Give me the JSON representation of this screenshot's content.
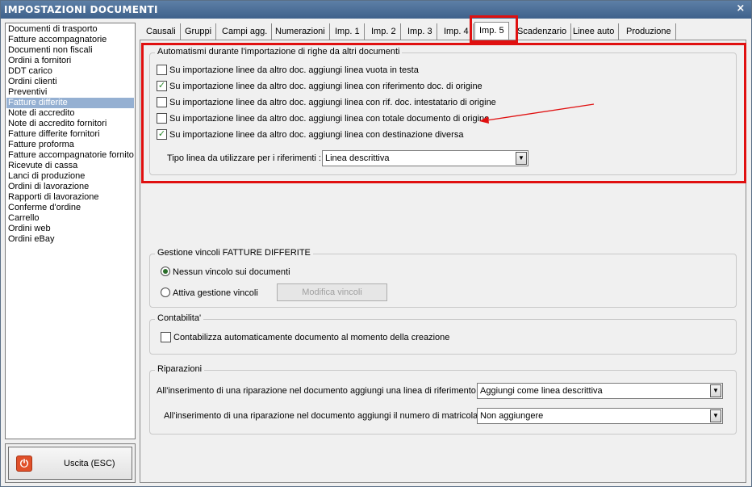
{
  "window": {
    "title": "IMPOSTAZIONI DOCUMENTI",
    "close_glyph": "×"
  },
  "doclist": {
    "items": [
      "Documenti di trasporto",
      "Fatture accompagnatorie",
      "Documenti non fiscali",
      "Ordini a fornitori",
      "DDT carico",
      "Ordini clienti",
      "Preventivi",
      "Fatture differite",
      "Note di accredito",
      "Note di accredito fornitori",
      "Fatture differite fornitori",
      "Fatture proforma",
      "Fatture accompagnatorie fornito",
      "Ricevute di cassa",
      "Lanci di produzione",
      "Ordini di lavorazione",
      "Rapporti di lavorazione",
      "Conferme d'ordine",
      "Carrello",
      "Ordini web",
      "Ordini eBay"
    ],
    "selected_index": 7
  },
  "exit": {
    "label": "Uscita (ESC)",
    "icon": "power-icon"
  },
  "tabs": [
    "Causali",
    "Gruppi",
    "Campi agg.",
    "Numerazioni",
    "Imp. 1",
    "Imp. 2",
    "Imp. 3",
    "Imp. 4",
    "Imp. 5",
    "Scadenzario",
    "Linee auto",
    "Produzione"
  ],
  "active_tab": "Imp. 5",
  "automatismi": {
    "title": "Automatismi durante l'importazione di righe da altri documenti",
    "options": [
      {
        "label": "Su importazione linee da altro doc. aggiungi linea vuota in testa",
        "checked": false
      },
      {
        "label": "Su importazione linee da altro doc. aggiungi linea con riferimento doc. di origine",
        "checked": true
      },
      {
        "label": "Su importazione linee da altro doc. aggiungi linea con rif. doc. intestatario di origine",
        "checked": false
      },
      {
        "label": "Su importazione linee da altro doc. aggiungi linea con totale documento di origine",
        "checked": false
      },
      {
        "label": "Su importazione linee da altro doc. aggiungi linea con destinazione diversa",
        "checked": true
      }
    ],
    "tipo_linea_label": "Tipo linea da utilizzare per i riferimenti :",
    "tipo_linea_value": "Linea descrittiva"
  },
  "vincoli": {
    "title": "Gestione vincoli FATTURE DIFFERITE",
    "option_none": "Nessun vincolo sui documenti",
    "option_attiva": "Attiva gestione vincoli",
    "selected": "none",
    "modifica_button": "Modifica vincoli"
  },
  "contabilita": {
    "title": "Contabilita'",
    "checkbox_label": "Contabilizza automaticamente documento al momento della creazione",
    "checked": false
  },
  "riparazioni": {
    "title": "Riparazioni",
    "row1_label": "All'inserimento di una riparazione nel documento aggiungi una linea di riferimento :",
    "row1_value": "Aggiungi come linea descrittiva",
    "row2_label": "All'inserimento di una riparazione nel documento aggiungi il numero di matricola :",
    "row2_value": "Non aggiungere"
  },
  "colors": {
    "highlight": "#e01010",
    "selection": "#95b0d2",
    "title_bar": "#4a6d96",
    "check": "#2c8a2c"
  }
}
